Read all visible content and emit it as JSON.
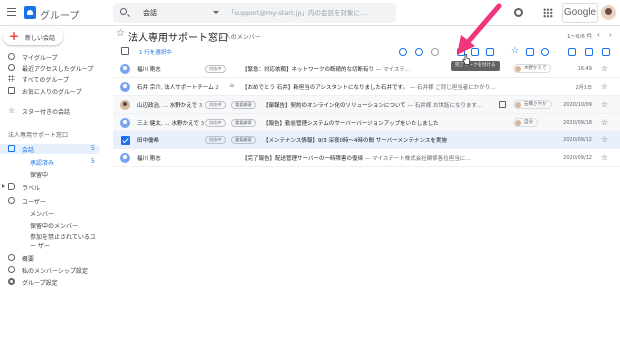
{
  "app": {
    "title": "グループ"
  },
  "search": {
    "scope": "会話",
    "placeholder": "「support@my-start.jp」内の会話を対象に…"
  },
  "header": {
    "google_label": "Google"
  },
  "sidebar": {
    "compose_label": "新しい会話",
    "items": [
      {
        "label": "マイグループ"
      },
      {
        "label": "最近アクセスしたグループ"
      },
      {
        "label": "すべてのグループ"
      },
      {
        "label": "お気に入りのグループ"
      }
    ],
    "starred_label": "スター付きの会話",
    "section_title": "法人専用サポート窓口",
    "conversations": {
      "label": "会話",
      "count": "5"
    },
    "assigned_to_me": {
      "label": "承認済み",
      "count": "5"
    },
    "pending": {
      "label": "保留中"
    },
    "labels": {
      "label": "ラベル"
    },
    "users": {
      "label": "ユーザー"
    },
    "members": {
      "label": "メンバー"
    },
    "pending_members": {
      "label": "保留中のメンバー"
    },
    "banned_members": {
      "label": "参加を禁止されているユー ザー"
    },
    "about": {
      "label": "概要"
    },
    "membership_settings": {
      "label": "私のメンバーシップ設定"
    },
    "group_settings": {
      "label": "グループ設定"
    }
  },
  "main": {
    "title": "法人専用サポート窓口",
    "member_count": "9 人のメンバー",
    "pagination": "1～6/6 件",
    "selection_text": "1 行を選択中",
    "tooltip": "完了マークを付ける"
  },
  "colors": {
    "accent": "#1a73e8",
    "arrow": "#f2347c",
    "selected_row": "#e8f0fe"
  },
  "rows": [
    {
      "sender": "福川 剛志",
      "count": "",
      "chips": [
        "対応中"
      ],
      "subject": "【緊急：対応依頼】ネットワークの断続的な切断有り",
      "snippet": " — マイステ…",
      "assignee": "木野かえで",
      "date": "16:49",
      "selected": false
    },
    {
      "sender": "石井 宗介, 法人サポートチーム",
      "count": " 2",
      "chips": [],
      "subject": "【おめでとう 石井】新担当のアシスタントになりました石井です。",
      "snippet": " — 石井様 ご同じ担当者にかかり…",
      "assignee": "",
      "date": "2月1日",
      "selected": false
    },
    {
      "sender": "山辺政治, … 水野かえで",
      "count": " 3",
      "chips": [
        "対応中",
        "重要顧客"
      ],
      "subject": "【御報告】契約のオンライン化のソリューションについて",
      "snippet": " — 石井様 お世話になります…",
      "assignee": "石橋さやか",
      "date": "2020/10/09",
      "selected": false
    },
    {
      "sender": "三上 健太, … 水野かえで",
      "count": " 3",
      "chips": [
        "対応中",
        "重要顧客"
      ],
      "subject": "【報告】勤怠管理システムのサーバーバージョンアップをいたしました",
      "snippet": "",
      "assignee": "自分",
      "date": "2020/09/18",
      "selected": false
    },
    {
      "sender": "田中優希",
      "count": "",
      "chips": [
        "対応中",
        "重要顧客"
      ],
      "subject": "【メンテナンス情報】9/3 深夜0時〜4時の間 サーバーメンテナンスを実施",
      "snippet": "",
      "assignee": "",
      "date": "2020/09/12",
      "selected": true
    },
    {
      "sender": "福川 剛志",
      "count": "",
      "chips": [],
      "subject": "【完了報告】配送管理サーバーの一時障害の復帰",
      "snippet": " — マイステート株式会社関係各位担当に…",
      "assignee": "",
      "date": "2020/09/12",
      "selected": false
    }
  ]
}
